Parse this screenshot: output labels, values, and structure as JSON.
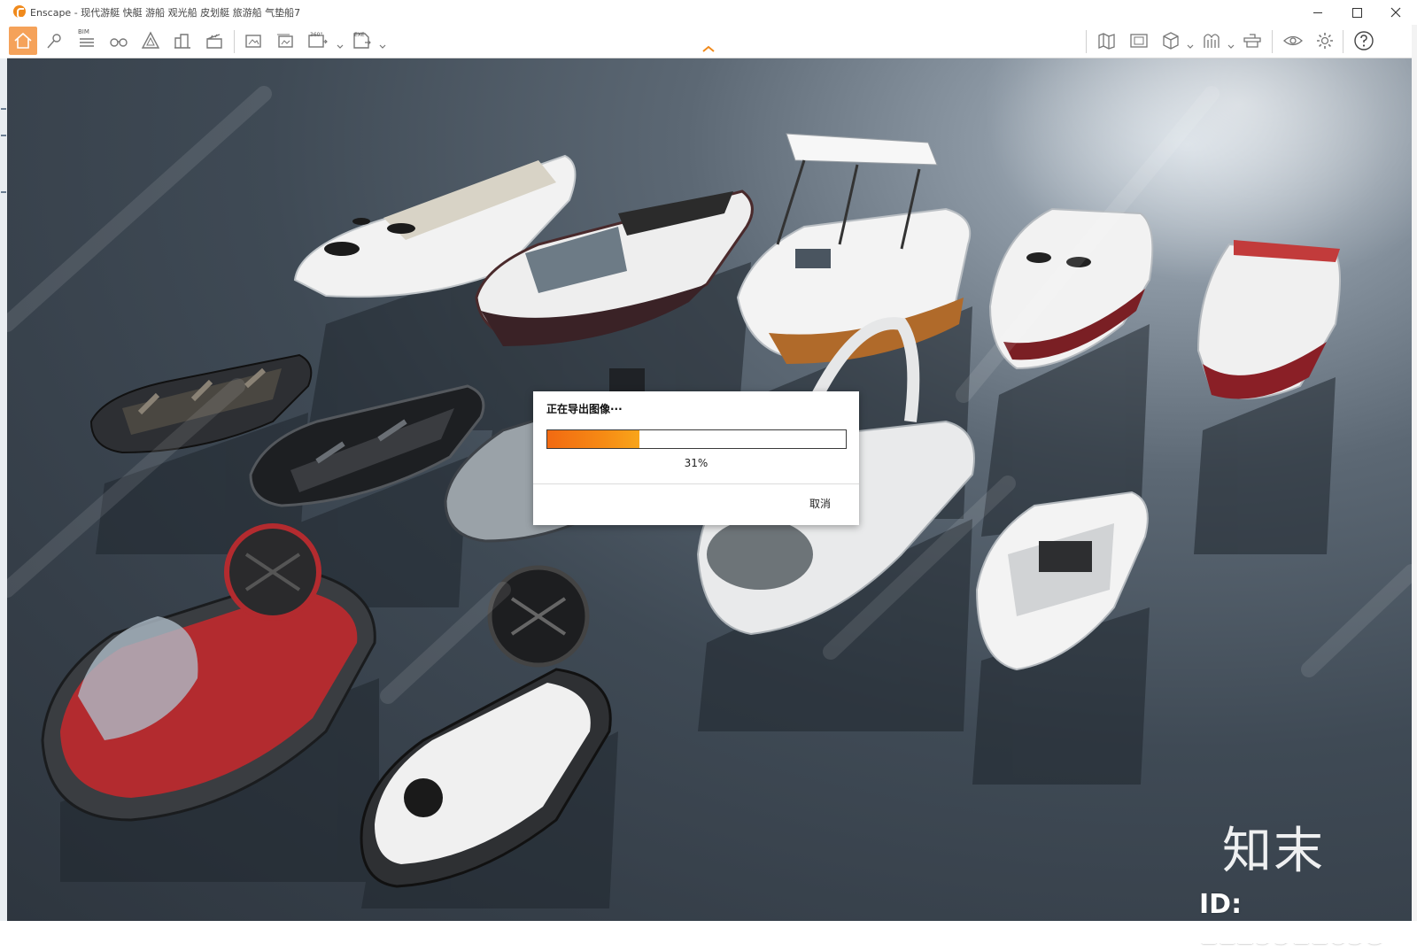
{
  "window": {
    "title": "Enscape - 现代游艇 快艇 游船 观光船 皮划艇 旅游船 气垫船7",
    "app_icon": "enscape-logo-icon"
  },
  "toolbar": {
    "bim_label": "BIM",
    "video_360_label": "360°",
    "exe_label": "EXE",
    "icons": [
      "home-icon",
      "pin-icon",
      "bim-list-icon",
      "binoculars-icon",
      "asset-triangle-icon",
      "buildings-icon",
      "clapperboard-icon",
      "screenshot-icon",
      "batch-render-icon",
      "panorama-360-icon",
      "export-exe-icon",
      "map-icon",
      "view-management-icon",
      "cube-icon",
      "material-icon",
      "capture-icon",
      "eye-icon",
      "settings-icon",
      "help-icon"
    ]
  },
  "dialog": {
    "title": "正在导出图像···",
    "progress_percent": 31,
    "progress_label": "31%",
    "cancel_label": "取消"
  },
  "watermark": {
    "brand": "知末",
    "id_text": "ID: 1129911698"
  },
  "colors": {
    "accent": "#f08a1c",
    "progress_start": "#f26a12",
    "progress_end": "#f9a51a",
    "home_active": "#f5a25a"
  }
}
